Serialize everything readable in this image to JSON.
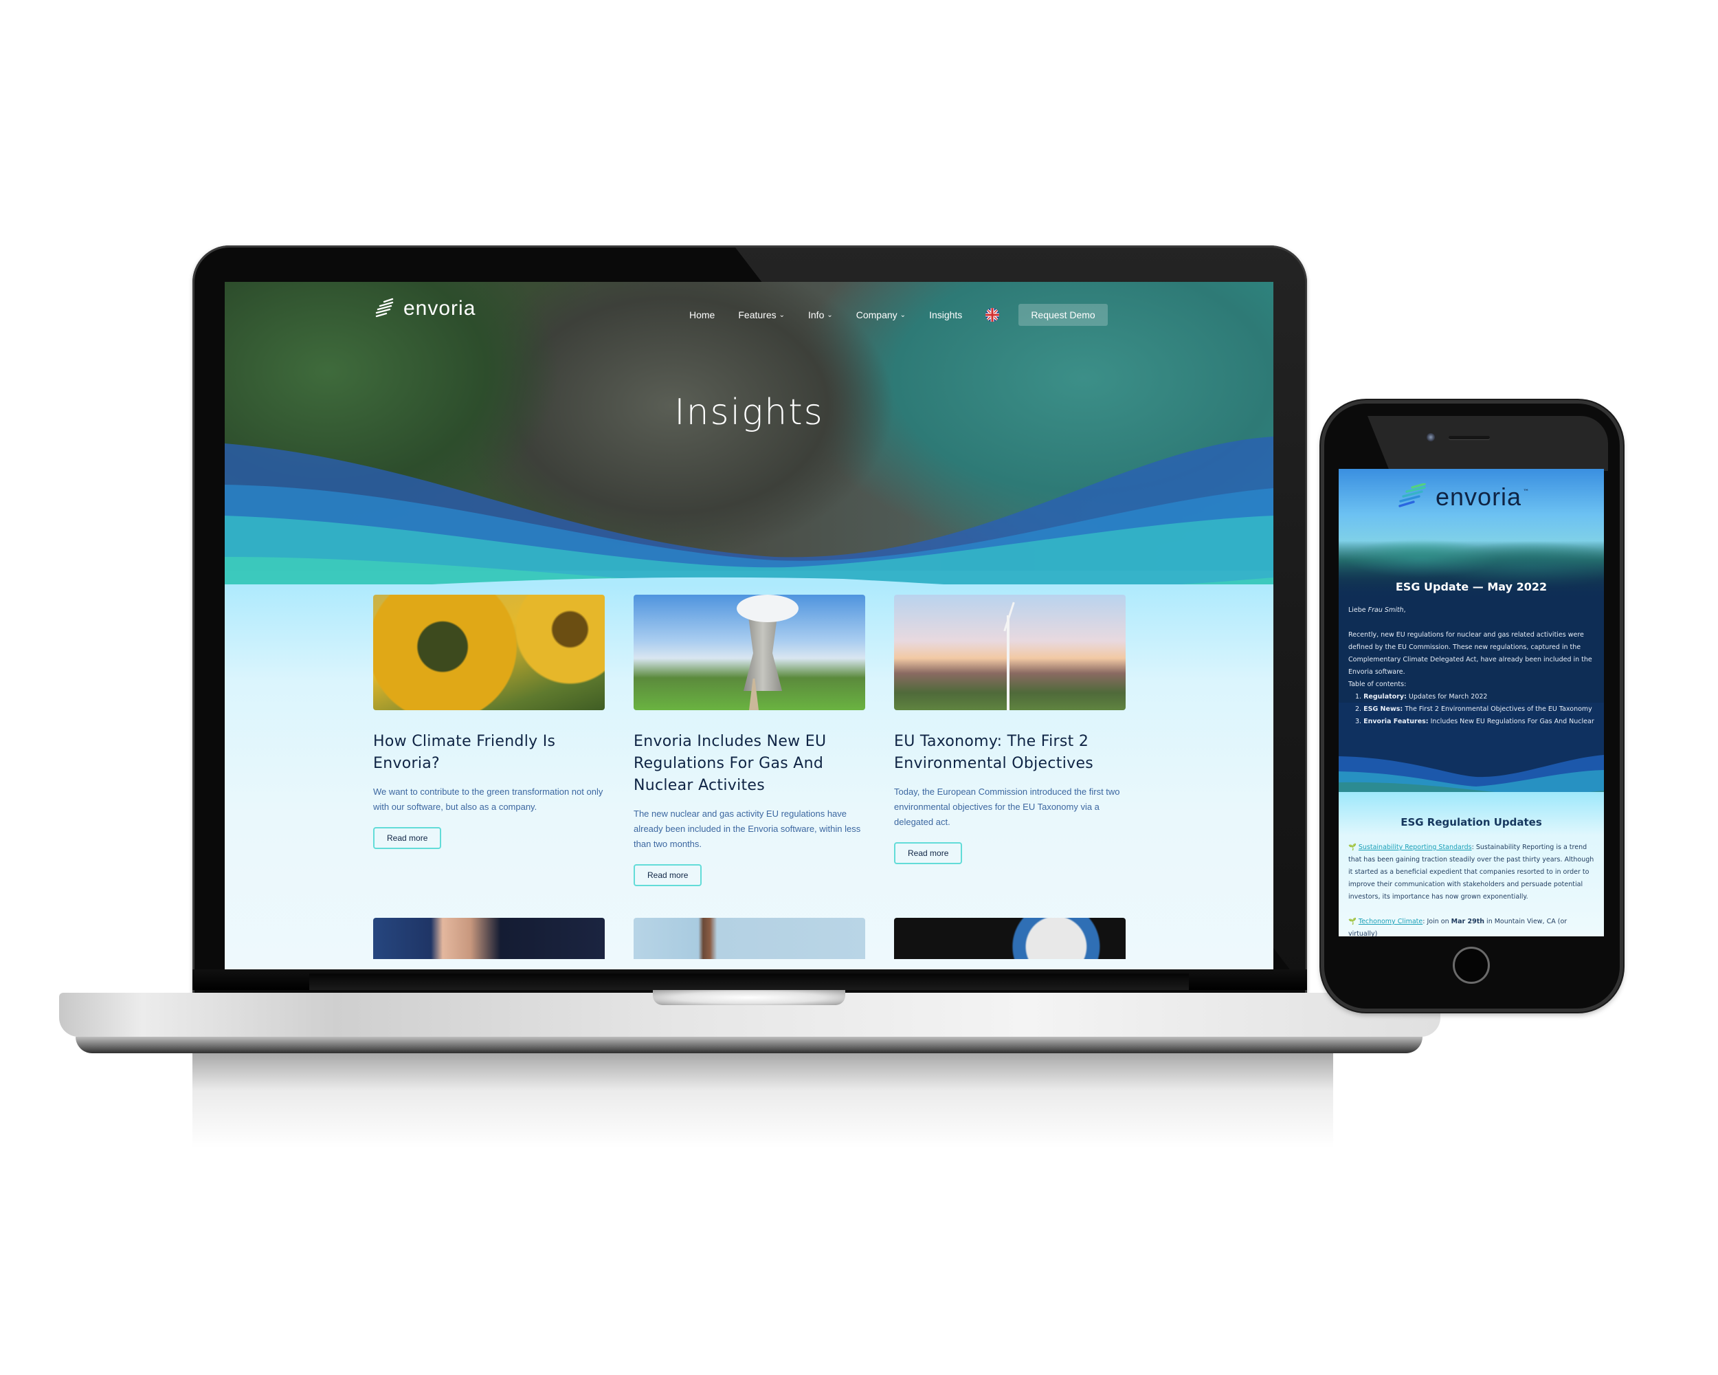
{
  "laptop_site": {
    "brand": "envoria",
    "nav": {
      "items": [
        {
          "label": "Home",
          "has_dropdown": false
        },
        {
          "label": "Features",
          "has_dropdown": true
        },
        {
          "label": "Info",
          "has_dropdown": true
        },
        {
          "label": "Company",
          "has_dropdown": true
        },
        {
          "label": "Insights",
          "has_dropdown": false
        }
      ],
      "language_icon": "uk-flag-icon",
      "cta_label": "Request Demo"
    },
    "hero_title": "Insights",
    "cards": [
      {
        "image": "sunflower-photo",
        "title": "How Climate Friendly Is Envoria?",
        "text": "We want to contribute to the green transformation not only with our software, but also as a company.",
        "button": "Read more"
      },
      {
        "image": "nuclear-plant-photo",
        "title": "Envoria Includes New EU Regulations For Gas And Nuclear Activites",
        "text": "The new nuclear and gas activity EU regulations have already been included in the Envoria software, within less than two months.",
        "button": "Read more"
      },
      {
        "image": "wind-turbine-photo",
        "title": "EU Taxonomy: The First 2 Environmental Objectives",
        "text": "Today, the European Commission introduced the first two environmental objectives for the EU Taxonomy via a delegated act.",
        "button": "Read more"
      }
    ],
    "cards_row2_images": [
      "business-hand-photo",
      "woman-sky-photo",
      "co2-dial-photo"
    ]
  },
  "phone_email": {
    "brand": "envoria",
    "trademark": "™",
    "heading": "ESG Update — May 2022",
    "greeting_prefix": "Liebe ",
    "greeting_name": "Frau Smith",
    "greeting_suffix": ",",
    "intro": "Recently, new EU regulations for nuclear and gas related activities were defined by the EU Commission. These new regulations, captured in the Complementary Climate Delegated Act, have already been included in the Envoria software.",
    "toc_label": "Table of contents:",
    "toc": [
      {
        "num": "1.",
        "bold": "Regulatory:",
        "text": " Updates for March 2022"
      },
      {
        "num": "2.",
        "bold": "ESG News:",
        "text": " The First 2 Environmental Objectives of the EU Taxonomy"
      },
      {
        "num": "3.",
        "bold": "Envoria Features:",
        "text": " Includes New EU Regulations For Gas And Nuclear"
      }
    ],
    "section_heading": "ESG Regulation Updates",
    "news": [
      {
        "icon": "sprout-icon",
        "link": "Sustainability Reporting Standards",
        "text": ": Sustainability Reporting is a trend that has been gaining traction steadily over the past thirty years. Although it started as a beneficial expedient that companies resorted to in order to improve their communication with stakeholders and persuade potential investors, its importance has now grown exponentially."
      },
      {
        "icon": "sprout-icon",
        "link": "Techonomy Climate",
        "text_before": ": Join on ",
        "bold": "Mar 29th",
        "text_after": " in Mountain View, CA (or virtually)"
      }
    ]
  },
  "colors": {
    "heading_navy": "#0f2444",
    "body_blue": "#3c67a0",
    "button_border_teal": "#62dcd8",
    "email_navy": "#0e2d55",
    "link_teal": "#1aa0b8"
  }
}
